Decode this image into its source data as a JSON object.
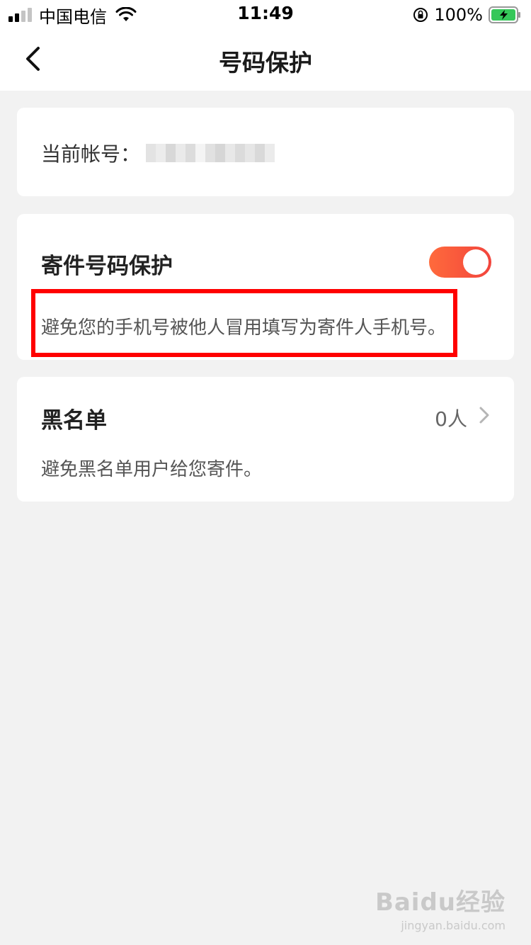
{
  "status_bar": {
    "carrier": "中国电信",
    "time": "11:49",
    "battery_percent": "100%",
    "signal_strength": 0.5
  },
  "nav": {
    "title": "号码保护",
    "back_icon": "chevron-left-icon"
  },
  "account": {
    "label": "当前帐号："
  },
  "protection": {
    "title": "寄件号码保护",
    "enabled": true,
    "description": "避免您的手机号被他人冒用填写为寄件人手机号。",
    "toggle_color": "#f2453d"
  },
  "blacklist": {
    "title": "黑名单",
    "count": "0人",
    "description": "避免黑名单用户给您寄件。",
    "chevron_icon": "chevron-right-icon"
  },
  "watermark": {
    "main": "Baidu经验",
    "sub": "jingyan.baidu.com"
  },
  "highlight_color": "#ff0000"
}
